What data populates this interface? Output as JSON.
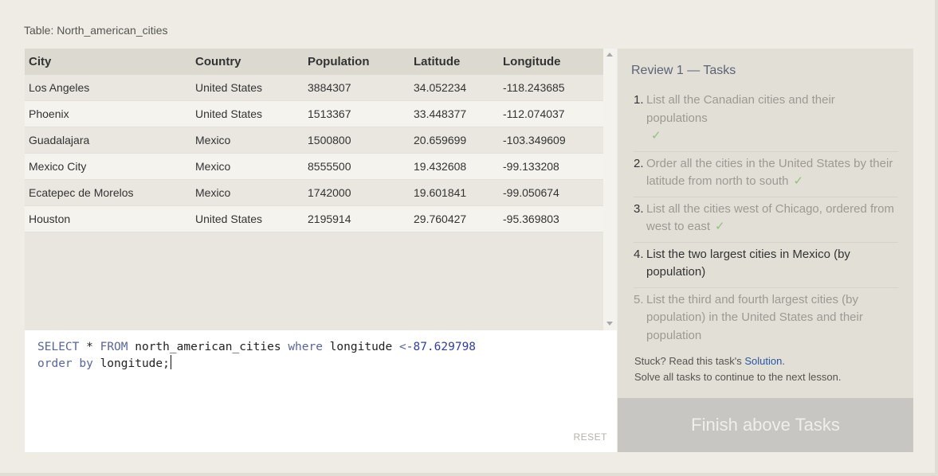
{
  "table": {
    "title": "Table: North_american_cities",
    "columns": [
      "City",
      "Country",
      "Population",
      "Latitude",
      "Longitude"
    ],
    "rows": [
      [
        "Los Angeles",
        "United States",
        "3884307",
        "34.052234",
        "-118.243685"
      ],
      [
        "Phoenix",
        "United States",
        "1513367",
        "33.448377",
        "-112.074037"
      ],
      [
        "Guadalajara",
        "Mexico",
        "1500800",
        "20.659699",
        "-103.349609"
      ],
      [
        "Mexico City",
        "Mexico",
        "8555500",
        "19.432608",
        "-99.133208"
      ],
      [
        "Ecatepec de Morelos",
        "Mexico",
        "1742000",
        "19.601841",
        "-99.050674"
      ],
      [
        "Houston",
        "United States",
        "2195914",
        "29.760427",
        "-95.369803"
      ]
    ]
  },
  "editor": {
    "line1": {
      "kw1": "SELECT",
      "star": " * ",
      "kw2": "FROM",
      "table": " north_american_cities ",
      "kw3": "where",
      "col": " longitude ",
      "op": "<",
      "num": "-87.629798"
    },
    "line2": {
      "kw1": "order by",
      "col": " longitude;"
    },
    "reset_label": "RESET"
  },
  "tasks": {
    "title": "Review 1 — Tasks",
    "items": [
      {
        "number": "1.",
        "text": "List all the Canadian cities and their populations",
        "status": "done",
        "check": "✓"
      },
      {
        "number": "2.",
        "text": "Order all the cities in the United States by their latitude from north to south",
        "status": "done",
        "check": "✓"
      },
      {
        "number": "3.",
        "text": "List all the cities west of Chicago, ordered from west to east",
        "status": "done",
        "check": "✓"
      },
      {
        "number": "4.",
        "text": "List the two largest cities in Mexico (by population)",
        "status": "current",
        "check": ""
      },
      {
        "number": "5.",
        "text": "List the third and fourth largest cities (by population) in the United States and their population",
        "status": "pending",
        "check": ""
      }
    ],
    "stuck_prefix": "Stuck? Read this task's ",
    "solution_link": "Solution",
    "stuck_suffix": ".",
    "continue_text": "Solve all tasks to continue to the next lesson.",
    "finish_button": "Finish above Tasks"
  },
  "colors": {
    "accent_link": "#2857a8",
    "check_green": "#8fc27b",
    "sql_keyword": "#5765a0",
    "sql_number": "#2f3ea8"
  }
}
